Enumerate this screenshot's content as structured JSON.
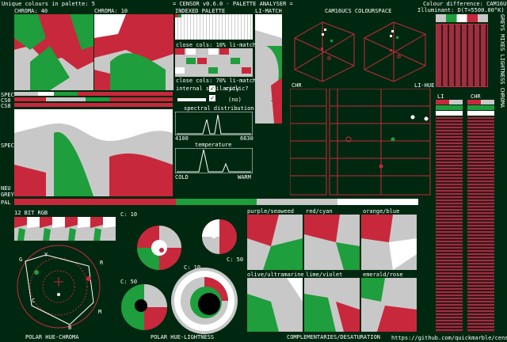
{
  "header": {
    "unique_colours": "Unique colours in palette: 5",
    "app_title": "= CENSOR v0.6.0 - PALETTE ANALYSER =",
    "colour_diff": "Colour difference: CAM16UCS",
    "illuminant": "Illuminant: D(T=5500.00°K)"
  },
  "panels": {
    "chroma_40": "CHROMA: 40",
    "chroma_10": "CHROMA: 10",
    "indexed_palette": "INDEXED PALETTE",
    "li_match_top": "LI-MATCH",
    "close_cols_10": "close cols: 10% li-match",
    "close_cols_70": "close cols: 70% li-match",
    "internal_similarity": "internal similarity",
    "cyclic": "cyclic?",
    "cyclic_value": "(no)",
    "spectral_distribution": "spectral distribution",
    "wl_min": "4100",
    "wl_max": "6630",
    "temperature": "temperature",
    "cold": "COLD",
    "warm": "WARM",
    "cam16_space": "CAM16UCS COLOURSPACE",
    "chr": "CHR",
    "li_hue": "LI-HUE",
    "li": "LI",
    "chr_right": "CHR",
    "greyscale_vertical": "GREYS MIXES LIGHTNESS CHROMA",
    "spec": "SPEC",
    "cs0": "CS0",
    "cs8": "CS8",
    "spec_bar": "SPEC",
    "neu": "NEU",
    "grey": "GREY",
    "pal": "PAL",
    "rgb_12bit": "12 BIT RGB",
    "c10_ring": "C: 10",
    "c50_small": "C: 50",
    "c50_left": "C: 50",
    "c10_big": "C: 10",
    "polar_hue_chroma": "POLAR HUE-CHROMA",
    "polar_hue_lightness": "POLAR HUE-LIGHTNESS",
    "complementaries": "COMPLEMENTARIES/DESATURATION",
    "url": "https://github.com/quickmarble/censor",
    "axis_labels": [
      "G",
      "Y",
      "R",
      "C",
      "M",
      "B"
    ]
  },
  "complements": [
    {
      "label": "purple/seaweed"
    },
    {
      "label": "red/cyan"
    },
    {
      "label": "orange/blue"
    },
    {
      "label": "olive/ultramarine"
    },
    {
      "label": "lime/violet"
    },
    {
      "label": "emerald/rose"
    }
  ],
  "colors": {
    "background": "#002810",
    "red": "#c8283c",
    "green": "#1e9e3c",
    "grey": "#c8c8c8",
    "white": "#ffffff",
    "black": "#000000"
  },
  "checkboxes": {
    "internal_similarity": true,
    "cyclic": true
  }
}
